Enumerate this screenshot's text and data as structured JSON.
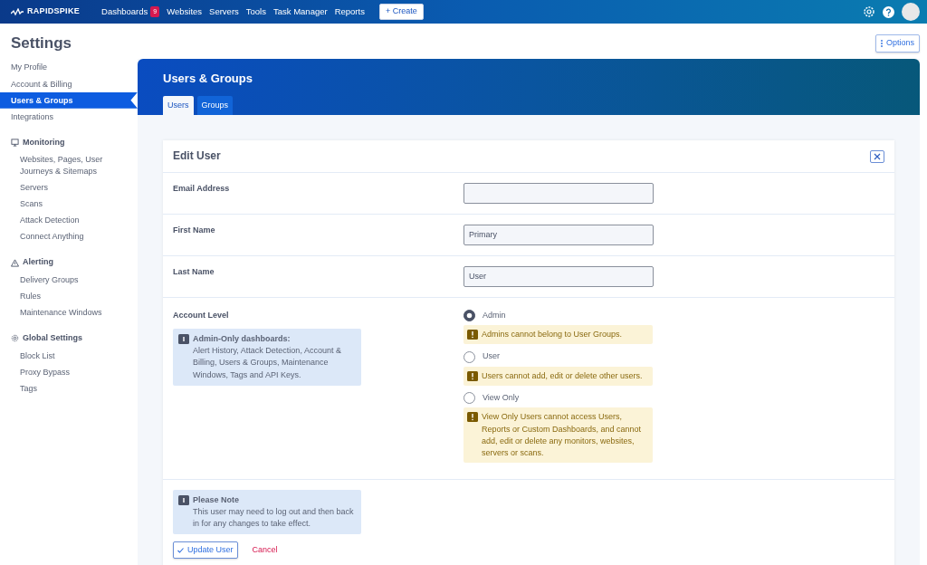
{
  "navbar": {
    "brand": "RAPIDSPIKE",
    "items": [
      {
        "label": "Dashboards",
        "badge": "9"
      },
      {
        "label": "Websites"
      },
      {
        "label": "Servers"
      },
      {
        "label": "Tools"
      },
      {
        "label": "Task Manager"
      },
      {
        "label": "Reports"
      }
    ],
    "create_button": "+ Create"
  },
  "page": {
    "title": "Settings",
    "options_button": "Options"
  },
  "sidebar": {
    "items": [
      {
        "label": "My Profile",
        "selected": false
      },
      {
        "label": "Account & Billing",
        "selected": false
      },
      {
        "label": "Users & Groups",
        "selected": true
      },
      {
        "label": "Integrations",
        "selected": false
      }
    ],
    "groups": [
      {
        "kind": "monitor",
        "title": "Monitoring",
        "items": [
          {
            "label": "Websites, Pages, User Journeys & Sitemaps",
            "selected": false
          },
          {
            "label": "Servers",
            "selected": false
          },
          {
            "label": "Scans",
            "selected": false
          },
          {
            "label": "Attack Detection",
            "selected": false
          },
          {
            "label": "Connect Anything",
            "selected": false
          }
        ]
      },
      {
        "kind": "alert",
        "title": "Alerting",
        "items": [
          {
            "label": "Delivery Groups",
            "selected": false
          },
          {
            "label": "Rules",
            "selected": false
          },
          {
            "label": "Maintenance Windows",
            "selected": false
          }
        ]
      },
      {
        "kind": "gear",
        "title": "Global Settings",
        "items": [
          {
            "label": "Block List",
            "selected": false
          },
          {
            "label": "Proxy Bypass",
            "selected": false
          },
          {
            "label": "Tags",
            "selected": false
          }
        ]
      }
    ]
  },
  "header": {
    "title": "Users & Groups",
    "tabs": [
      {
        "label": "Users",
        "selected": true
      },
      {
        "label": "Groups",
        "selected": false
      }
    ]
  },
  "edit_user": {
    "title": "Edit User",
    "fields": [
      {
        "label": "Email Address"
      },
      {
        "label": "First Name",
        "value": "Primary"
      },
      {
        "label": "Last Name",
        "value": "User"
      }
    ],
    "account_level": {
      "label": "Account Level",
      "info_title": "Admin-Only dashboards:",
      "info_text": "Alert History, Attack Detection, Account & Billing, Users & Groups, Maintenance Windows, Tags and API Keys.",
      "options": [
        {
          "label": "Admin",
          "selected": true,
          "warning": "Admins cannot belong to User Groups."
        },
        {
          "label": "User",
          "selected": false,
          "warning": "Users cannot add, edit or delete other users."
        },
        {
          "label": "View Only",
          "selected": false,
          "warning": "View Only Users cannot access Users, Reports or Custom Dashboards, and cannot add, edit or delete any monitors, websites, servers or scans."
        }
      ]
    },
    "note_title": "Please Note",
    "note_text": "This user may need to log out and then back in for any changes to take effect.",
    "update_button": "Update User",
    "cancel_link": "Cancel"
  }
}
